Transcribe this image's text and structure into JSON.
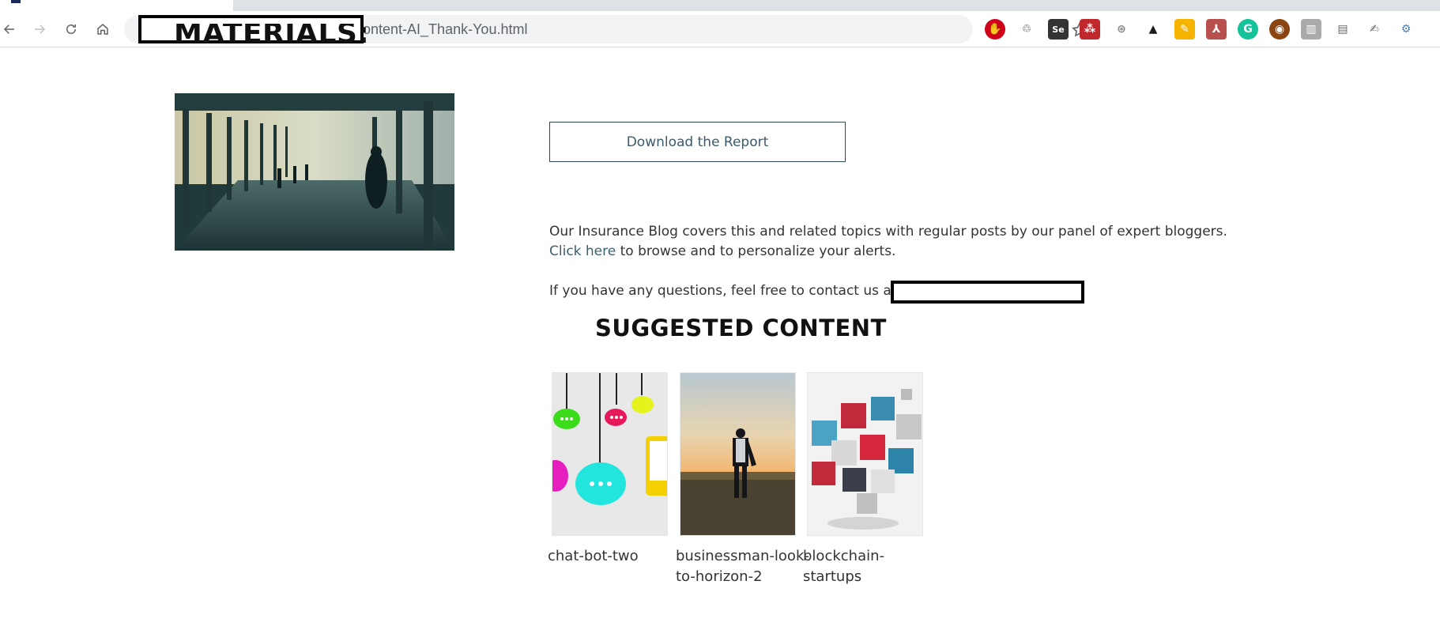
{
  "browser": {
    "url_suffix": "ontent-AI_Thank-You.html",
    "extensions": [
      "adblock-icon",
      "puzzle-icon",
      "selenium-icon",
      "tools-icon",
      "globe-icon",
      "drive-icon",
      "notes-icon",
      "pdf-icon",
      "grammarly-icon",
      "cookie-icon",
      "book-icon",
      "doc-icon",
      "edit-icon",
      "settings-icon"
    ]
  },
  "page": {
    "section_heading": "MATERIALS:",
    "download_label": "Download the Report",
    "blog_line": "Our Insurance Blog covers this and related topics with regular posts by our panel of expert bloggers.",
    "click_here": "Click here",
    "browse_text": " to browse and to personalize your alerts.",
    "contact_text": "If you have any questions, feel free to contact us at",
    "suggested_heading": "SUGGESTED CONTENT"
  },
  "suggested": [
    {
      "title": "chat-bot-two"
    },
    {
      "title": "businessman-look-to-horizon-2"
    },
    {
      "title": "blockchain-startups"
    }
  ],
  "colors": {
    "link": "#3c5f6e",
    "button_border": "#2d4a57",
    "heading": "#111111"
  }
}
